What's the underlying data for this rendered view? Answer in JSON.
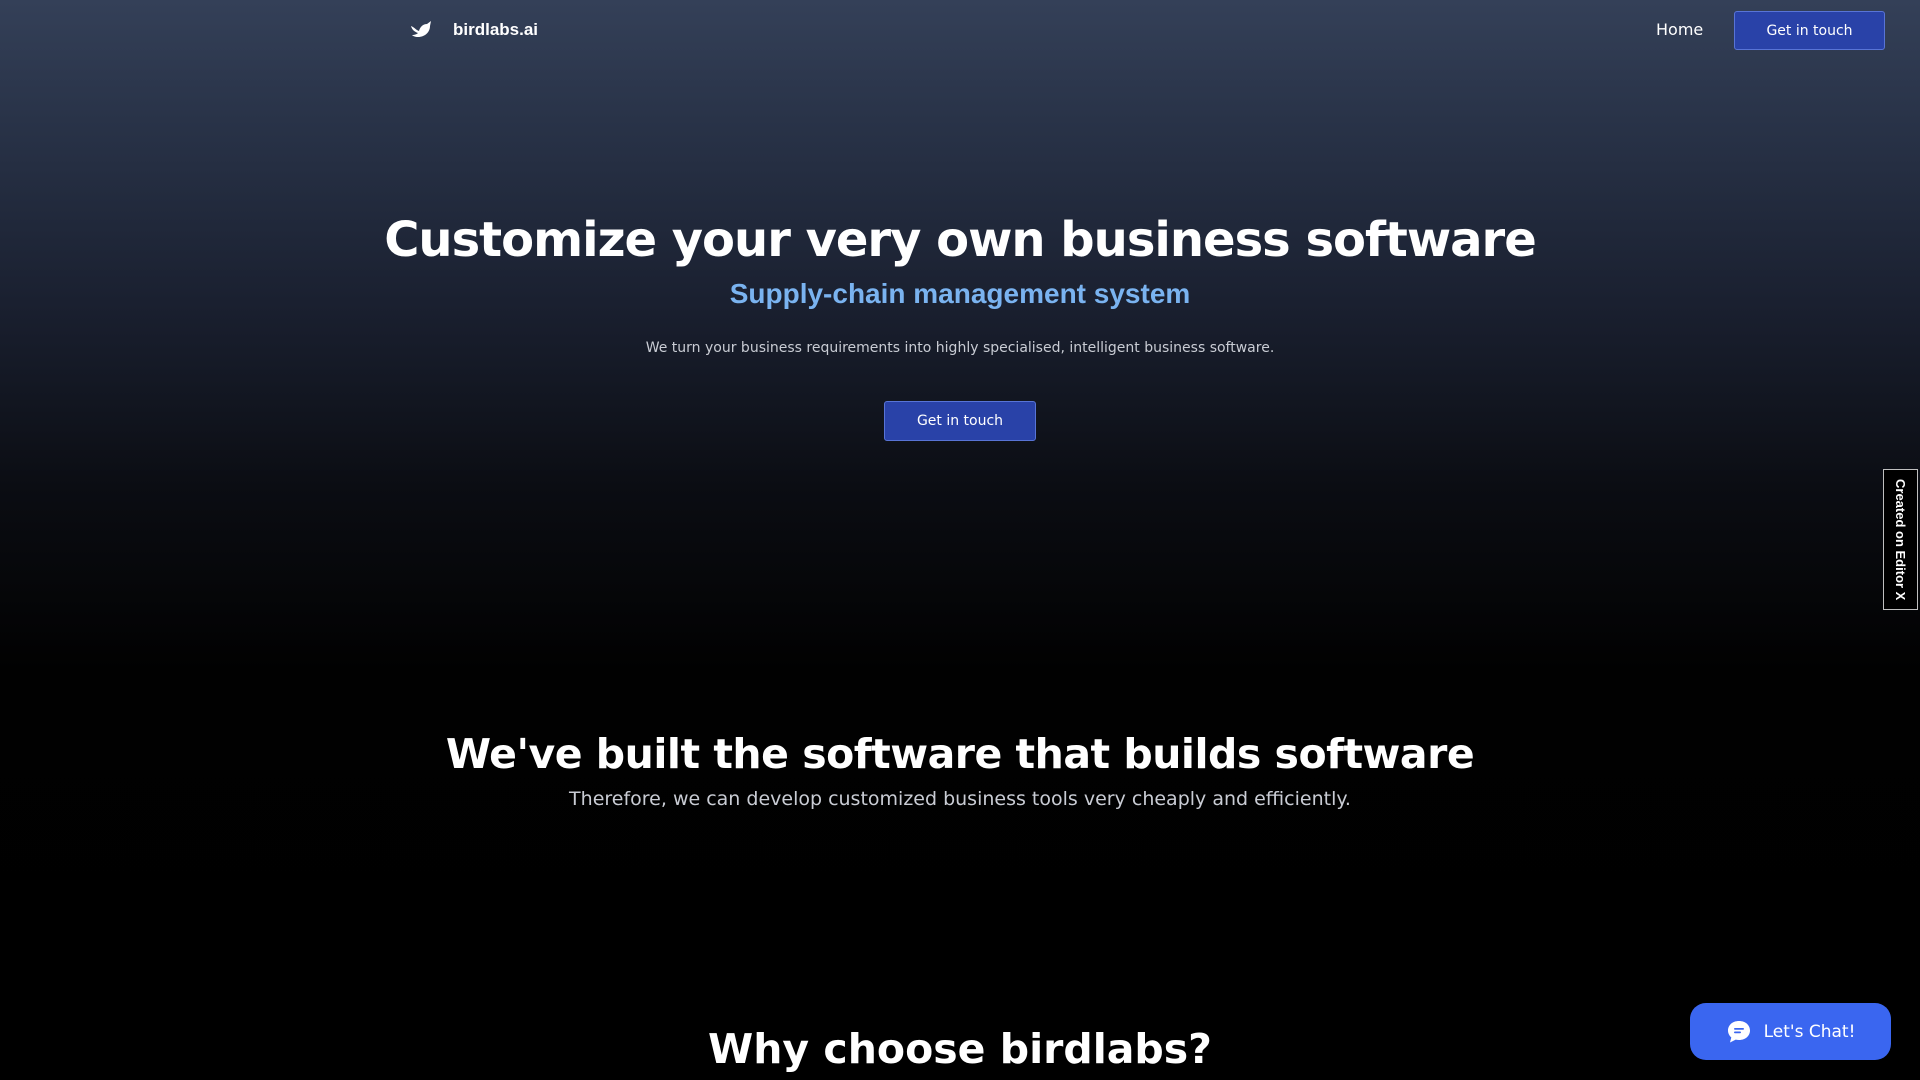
{
  "header": {
    "brand": "birdlabs.ai",
    "logo_icon": "bird-icon",
    "nav_home": "Home",
    "cta_label": "Get in touch"
  },
  "hero": {
    "title": "Customize your very own business software",
    "subtitle": "Supply-chain management system",
    "description": "We turn your business requirements into highly specialised, intelligent business software.",
    "cta_label": "Get in touch"
  },
  "section_software": {
    "title": "We've built the software that builds software",
    "subtitle": "Therefore, we can develop customized business tools very cheaply and efficiently."
  },
  "section_why": {
    "title": "Why choose birdlabs?"
  },
  "side_badge": {
    "label": "Created on Editor X"
  },
  "chat": {
    "label": "Let's Chat!",
    "icon": "chat-bubble-icon"
  },
  "colors": {
    "accent_button": "#2942a8",
    "subtitle_blue": "#7ab3f0",
    "chat_blue": "#3a66f0"
  }
}
